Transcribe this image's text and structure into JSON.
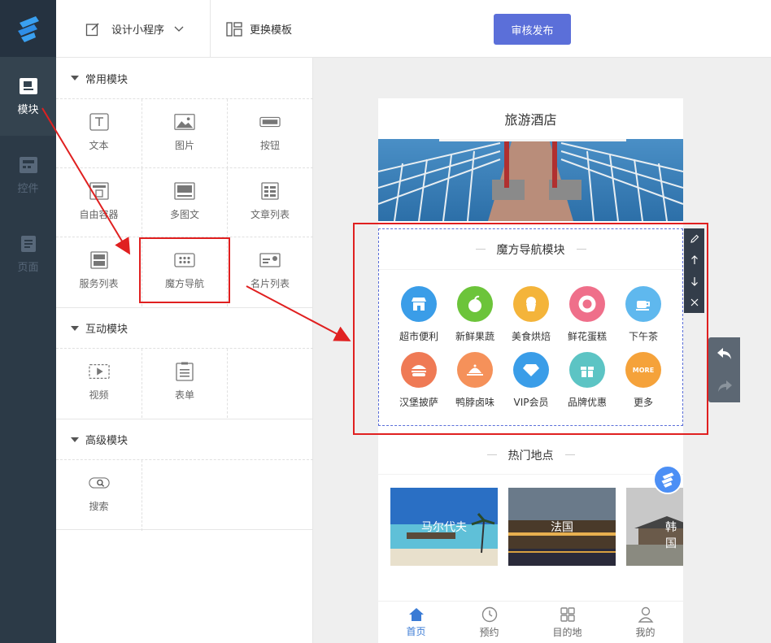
{
  "rail": {
    "items": [
      {
        "label": "模块",
        "icon": "module-icon",
        "active": true
      },
      {
        "label": "控件",
        "icon": "widget-icon",
        "active": false
      },
      {
        "label": "页面",
        "icon": "page-icon",
        "active": false
      }
    ]
  },
  "topbar": {
    "design_label": "设计小程序",
    "template_label": "更换模板",
    "publish_label": "审核发布"
  },
  "panel": {
    "sections": [
      {
        "title": "常用模块",
        "items": [
          "文本",
          "图片",
          "按钮",
          "自由容器",
          "多图文",
          "文章列表",
          "服务列表",
          "魔方导航",
          "名片列表"
        ]
      },
      {
        "title": "互动模块",
        "items": [
          "视频",
          "表单"
        ]
      },
      {
        "title": "高级模块",
        "items": [
          "搜索"
        ]
      }
    ]
  },
  "phone": {
    "title": "旅游酒店",
    "magic_title": "魔方导航模块",
    "nav_items": [
      {
        "label": "超市便利",
        "color": "#3a9de8"
      },
      {
        "label": "新鲜果蔬",
        "color": "#6cc43a"
      },
      {
        "label": "美食烘焙",
        "color": "#f4b43a"
      },
      {
        "label": "鲜花蛋糕",
        "color": "#ef6f8a"
      },
      {
        "label": "下午茶",
        "color": "#5fb8ee"
      },
      {
        "label": "汉堡披萨",
        "color": "#ef7a55"
      },
      {
        "label": "鸭脖卤味",
        "color": "#f5915a"
      },
      {
        "label": "VIP会员",
        "color": "#3a9de8"
      },
      {
        "label": "品牌优惠",
        "color": "#5cc4c4"
      },
      {
        "label": "更多",
        "color": "#f5a23a",
        "badge": "MORE"
      }
    ],
    "hot_title": "热门地点",
    "places": [
      "马尔代夫",
      "法国",
      "韩国"
    ],
    "tabs": [
      {
        "label": "首页",
        "active": true
      },
      {
        "label": "预约",
        "active": false
      },
      {
        "label": "目的地",
        "active": false
      },
      {
        "label": "我的",
        "active": false
      }
    ]
  },
  "colors": {
    "accent": "#5b6fd9",
    "rail": "#2c3a47",
    "annotation": "#e02020"
  }
}
